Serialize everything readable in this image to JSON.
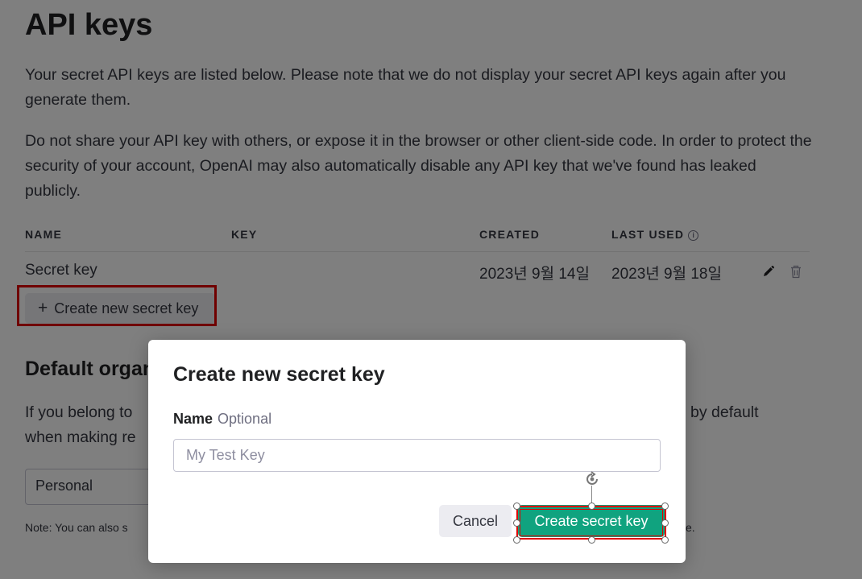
{
  "page": {
    "title": "API keys",
    "intro_paragraph": "Your secret API keys are listed below. Please note that we do not display your secret API keys again after you generate them.",
    "security_paragraph": "Do not share your API key with others, or expose it in the browser or other client-side code. In order to protect the security of your account, OpenAI may also automatically disable any API key that we've found has leaked publicly."
  },
  "table": {
    "headers": {
      "name": "NAME",
      "key": "KEY",
      "created": "CREATED",
      "last_used": "LAST USED"
    },
    "info_icon": "info-circle-icon",
    "rows": [
      {
        "name": "Secret key",
        "key": "",
        "created": "2023년 9월 14일",
        "last_used": "2023년 9월 18일",
        "actions": [
          "pencil-icon",
          "trash-icon"
        ]
      }
    ]
  },
  "create_new_button": {
    "icon": "+",
    "label": "Create new secret key"
  },
  "default_org": {
    "title_visible": "Default organ",
    "description_visible_left": "If you belong to",
    "description_visible_left_line2": "when making re",
    "description_visible_right": "by default",
    "select_value": "Personal",
    "note_visible_left": "Note: You can also s",
    "note_visible_right": "e."
  },
  "modal": {
    "title": "Create new secret key",
    "field_label": "Name",
    "field_optional": "Optional",
    "field_placeholder": "My Test Key",
    "field_value": "",
    "cancel_label": "Cancel",
    "submit_label": "Create secret key"
  },
  "colors": {
    "accent": "#10a37f",
    "highlight": "#e00000",
    "overlay": "rgba(0,0,0,0.5)"
  }
}
